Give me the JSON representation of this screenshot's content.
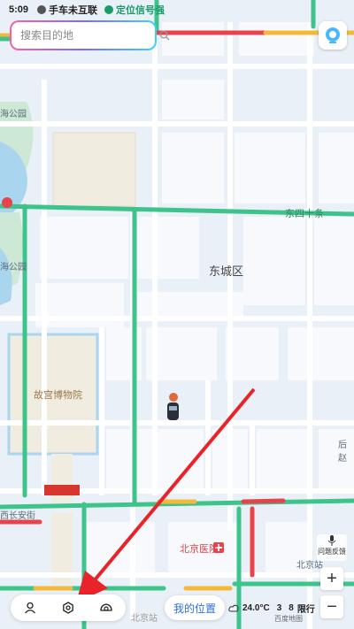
{
  "status_bar": {
    "time": "5:09",
    "sim_text": "手车未互联",
    "gps_text": "定位信号强"
  },
  "search": {
    "placeholder": "搜索目的地"
  },
  "map_labels": {
    "park_top": "海公园",
    "park_mid": "海公园",
    "district": "东城区",
    "road_north": "东四十条",
    "palace": "故宫博物院",
    "road_west": "西长安街",
    "hospital": "北京医院",
    "station": "北京站",
    "hall_short": "后赵",
    "bottom_road": "北京站"
  },
  "controls": {
    "my_position": "我的位置",
    "feedback": "问题反馈",
    "zoom_in": "+",
    "zoom_out": "−",
    "user_icon": "user-icon",
    "settings_icon": "settings-icon",
    "car_icon": "car-icon"
  },
  "weather": {
    "temp": "24.0°C",
    "plate_a": "3",
    "plate_b": "8",
    "restriction": "限行"
  },
  "watermark": "百度地图",
  "colors": {
    "road_green": "#3ec48a",
    "road_red": "#e8434b",
    "road_yellow": "#f5b93a",
    "arrow": "#e8232a",
    "accent_blue": "#2a6fe0"
  }
}
